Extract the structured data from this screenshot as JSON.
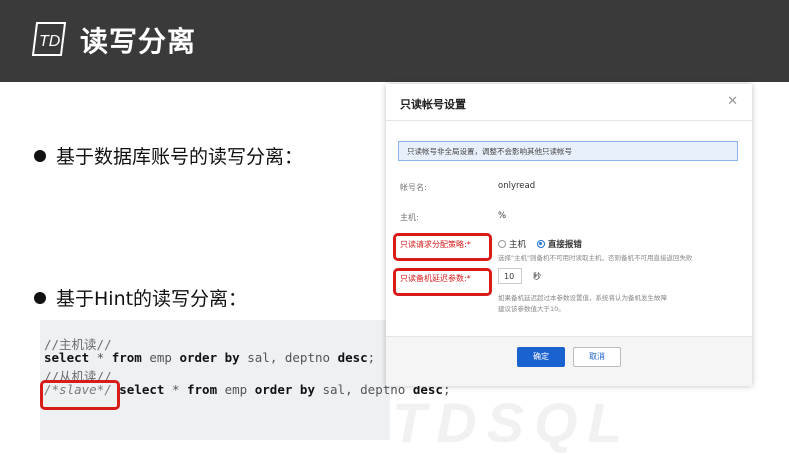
{
  "header": {
    "logo": "TD",
    "title": "读写分离",
    "background": "#3a3a3a"
  },
  "bullets": [
    {
      "text": "基于数据库账号的读写分离："
    },
    {
      "text": "基于Hint的读写分离："
    }
  ],
  "code": {
    "line1": "//主机读//",
    "line2": {
      "select": "select",
      "star1": " * ",
      "from": "from",
      "t1": " emp ",
      "order": "order",
      "sp": " ",
      "by": "by",
      "t2": " sal, deptno ",
      "desc": "desc",
      "semi": ";"
    },
    "line3": "//从机读//",
    "line4": {
      "hint": "/*slave*/",
      "select": "select",
      "star1": " * ",
      "from": "from",
      "t1": " emp ",
      "order": "order",
      "sp": " ",
      "by": "by",
      "t2": " sal, deptno ",
      "desc": "desc",
      "semi": ";"
    }
  },
  "dialog": {
    "title": "只读帐号设置",
    "close_icon": "close-icon",
    "notice": "只读帐号非全局设置，调整不会影响其他只读帐号",
    "account_label": "帐号名:",
    "account_value": "onlyread",
    "host_label": "主机:",
    "host_value": "%",
    "strategy_label": "只读请求分配策略:*",
    "option_master": "主机",
    "option_direct": "直接报错",
    "selected_option": "直接报错",
    "strategy_hint": "选择\"主机\"则备机不可用时读取主机，否则备机不可用直接返回失败",
    "delay_label": "只读备机延迟参数:*",
    "delay_value": "10",
    "delay_unit": "秒",
    "delay_hint1": "如果备机延迟超过本参数设置值，系统将认为备机发生故障",
    "delay_hint2": "建议该参数值大于10。",
    "ok_label": "确定",
    "cancel_label": "取消"
  },
  "watermark": "TDSQL",
  "colors": {
    "highlight": "#d81c1c",
    "primary": "#1a62cf",
    "notice_bg": "#e8f1fb"
  }
}
